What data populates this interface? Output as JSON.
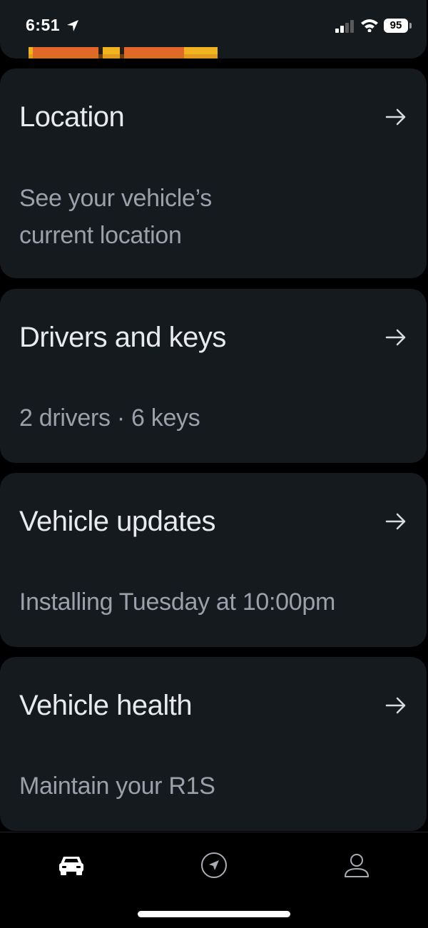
{
  "status_bar": {
    "time": "6:51",
    "battery": "95"
  },
  "cards": [
    {
      "title": "Location",
      "subtitle_line1": "See your vehicle’s",
      "subtitle_line2": "current location"
    },
    {
      "title": "Drivers and keys",
      "subtitle": "2 drivers · 6 keys"
    },
    {
      "title": "Vehicle updates",
      "subtitle": "Installing Tuesday at 10:00pm"
    },
    {
      "title": "Vehicle health",
      "subtitle": "Maintain your R1S"
    }
  ],
  "tab_bar": {
    "tabs": [
      {
        "icon": "car-icon",
        "active": true
      },
      {
        "icon": "navigation-icon",
        "active": false
      },
      {
        "icon": "profile-icon",
        "active": false
      }
    ]
  },
  "colors": {
    "background": "#000000",
    "card": "#151a1f",
    "title": "#e8eaee",
    "subtitle": "#9aa1aa",
    "accent_image": "#f2b320"
  }
}
